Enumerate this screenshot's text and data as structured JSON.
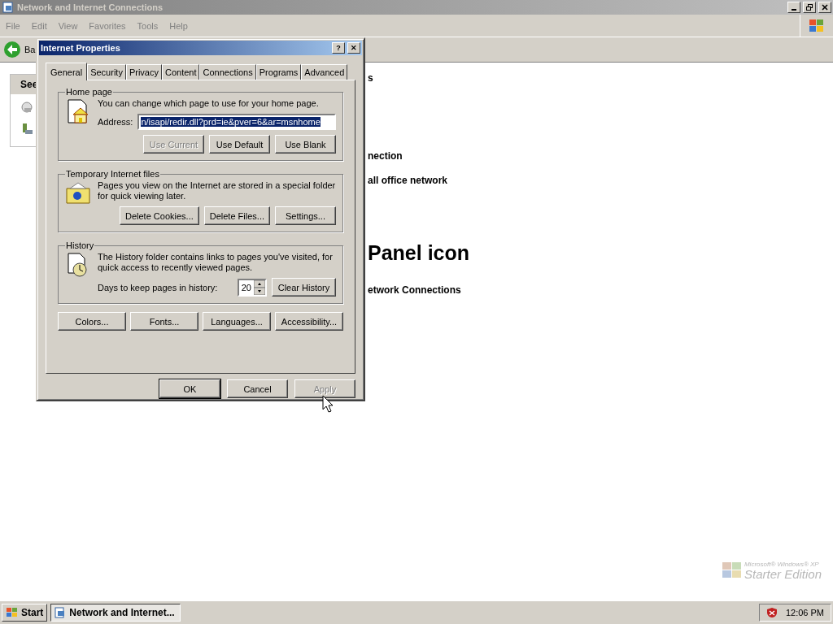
{
  "explorer": {
    "title": "Network and Internet Connections",
    "active": false,
    "menu": [
      "File",
      "Edit",
      "View",
      "Favorites",
      "Tools",
      "Help"
    ],
    "back_button": "Ba",
    "side_panel": {
      "title": "See"
    },
    "content": [
      {
        "kind": "link",
        "text": "s"
      },
      {
        "kind": "link",
        "text": "nection"
      },
      {
        "kind": "link",
        "text": "all office network"
      },
      {
        "kind": "heading",
        "text": "Panel icon"
      },
      {
        "kind": "link",
        "text": "etwork Connections"
      }
    ]
  },
  "dialog": {
    "title": "Internet Properties",
    "help": "?",
    "close": "✕",
    "tabs": [
      {
        "label": "General",
        "selected": true
      },
      {
        "label": "Security",
        "selected": false
      },
      {
        "label": "Privacy",
        "selected": false
      },
      {
        "label": "Content",
        "selected": false
      },
      {
        "label": "Connections",
        "selected": false
      },
      {
        "label": "Programs",
        "selected": false
      },
      {
        "label": "Advanced",
        "selected": false
      }
    ],
    "home_page": {
      "label": "Home page",
      "text": "You can change which page to use for your home page.",
      "address_label": "Address:",
      "address": "n/isapi/redir.dll?prd=ie&pver=6&ar=msnhome",
      "address_selected": true,
      "buttons": [
        {
          "label": "Use Current",
          "disabled": true
        },
        {
          "label": "Use Default",
          "disabled": false
        },
        {
          "label": "Use Blank",
          "disabled": false
        }
      ]
    },
    "temp_files": {
      "label": "Temporary Internet files",
      "text": "Pages you view on the Internet are stored in a special folder for quick viewing later.",
      "buttons": [
        {
          "label": "Delete Cookies...",
          "disabled": false
        },
        {
          "label": "Delete Files...",
          "disabled": false
        },
        {
          "label": "Settings...",
          "disabled": false
        }
      ]
    },
    "history": {
      "label": "History",
      "text": "The History folder contains links to pages you've visited, for quick access to recently viewed pages.",
      "days_label": "Days to keep pages in history:",
      "days": "20",
      "button": {
        "label": "Clear History",
        "disabled": false
      }
    },
    "bottom_buttons": [
      {
        "label": "Colors...",
        "disabled": false
      },
      {
        "label": "Fonts...",
        "disabled": false
      },
      {
        "label": "Languages...",
        "disabled": false
      },
      {
        "label": "Accessibility...",
        "disabled": false
      }
    ],
    "footer_buttons": [
      {
        "label": "OK",
        "disabled": false,
        "default": true
      },
      {
        "label": "Cancel",
        "disabled": false,
        "default": false
      },
      {
        "label": "Apply",
        "disabled": true,
        "default": false
      }
    ]
  },
  "desktop_logo": {
    "line_1": "Microsoft® Windows® XP",
    "line_2": "Starter Edition"
  },
  "taskbar": {
    "start": "Start",
    "tasks": [
      {
        "label": "Network and Internet...",
        "selected": true
      }
    ],
    "clock": "12:06 PM"
  }
}
